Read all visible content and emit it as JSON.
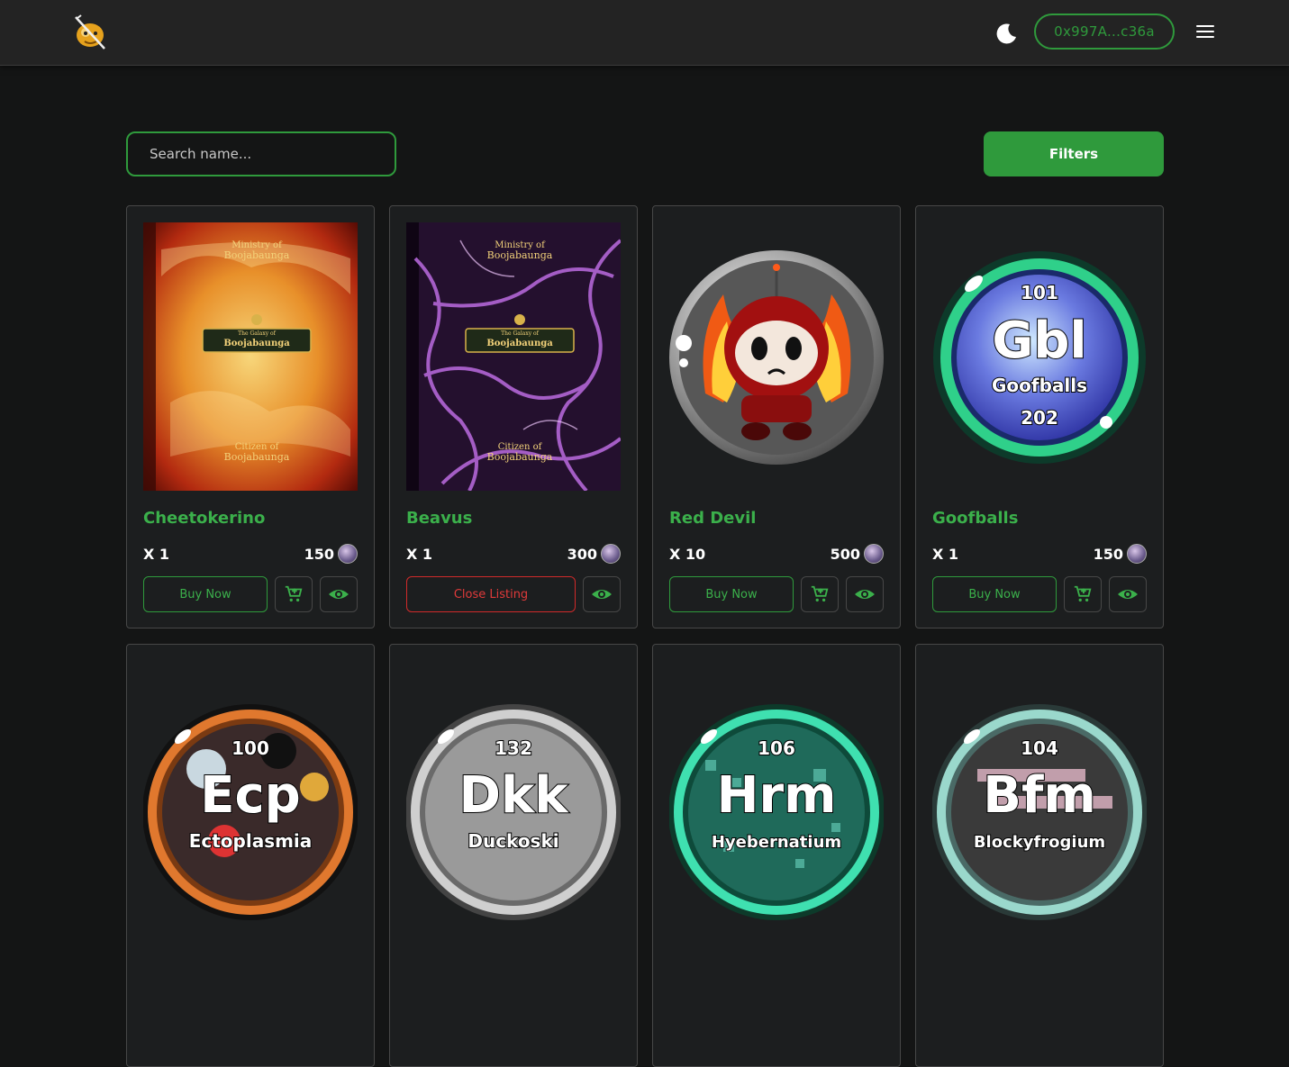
{
  "header": {
    "logo_icon": "boojabaunga-logo-icon",
    "theme_icon": "moon-icon",
    "wallet_address": "0x997A...c36a",
    "menu_icon": "hamburger-menu-icon"
  },
  "toolbar": {
    "search_placeholder": "Search name...",
    "filters_label": "Filters"
  },
  "colors": {
    "accent": "#2f9a3c",
    "danger": "#d12a2a",
    "card_bg": "#1c1e1f",
    "page_bg": "#141515"
  },
  "cards": [
    {
      "name": "Cheetokerino",
      "qty": "X 1",
      "price": "150",
      "action": "Buy Now",
      "cover": "book",
      "book": {
        "line1": "Ministry of",
        "line2": "Boojabaunga",
        "banner_top": "The Galaxy of",
        "banner_main": "Boojabaunga",
        "line3": "Citizen of",
        "line4": "Boojabaunga"
      }
    },
    {
      "name": "Beavus",
      "qty": "X 1",
      "price": "300",
      "action": "Close Listing",
      "cover": "book",
      "book": {
        "line1": "Ministry of",
        "line2": "Boojabaunga",
        "banner_top": "The Galaxy of",
        "banner_main": "Boojabaunga",
        "line3": "Citizen of",
        "line4": "Boojabaunga"
      }
    },
    {
      "name": "Red Devil",
      "qty": "X 10",
      "price": "500",
      "action": "Buy Now",
      "cover": "character"
    },
    {
      "name": "Goofballs",
      "qty": "X 1",
      "price": "150",
      "action": "Buy Now",
      "cover": "element",
      "element": {
        "num_top": "101",
        "symbol": "Gbl",
        "label": "Goofballs",
        "num_bottom": "202"
      }
    },
    {
      "name": "",
      "qty": "",
      "price": "",
      "action": "",
      "cover": "element",
      "element": {
        "num_top": "100",
        "symbol": "Ecp",
        "label": "Ectoplasmia"
      }
    },
    {
      "name": "",
      "qty": "",
      "price": "",
      "action": "",
      "cover": "element",
      "element": {
        "num_top": "132",
        "symbol": "Dkk",
        "label": "Duckoski"
      }
    },
    {
      "name": "",
      "qty": "",
      "price": "",
      "action": "",
      "cover": "element",
      "element": {
        "num_top": "106",
        "symbol": "Hrm",
        "label": "Hyebernatium"
      }
    },
    {
      "name": "",
      "qty": "",
      "price": "",
      "action": "",
      "cover": "element",
      "element": {
        "num_top": "104",
        "symbol": "Bfm",
        "label": "Blockyfrogium"
      }
    }
  ],
  "icons": {
    "cart": "add-to-cart-icon",
    "view": "eye-icon",
    "currency": "boojabaunga-coin-icon"
  }
}
